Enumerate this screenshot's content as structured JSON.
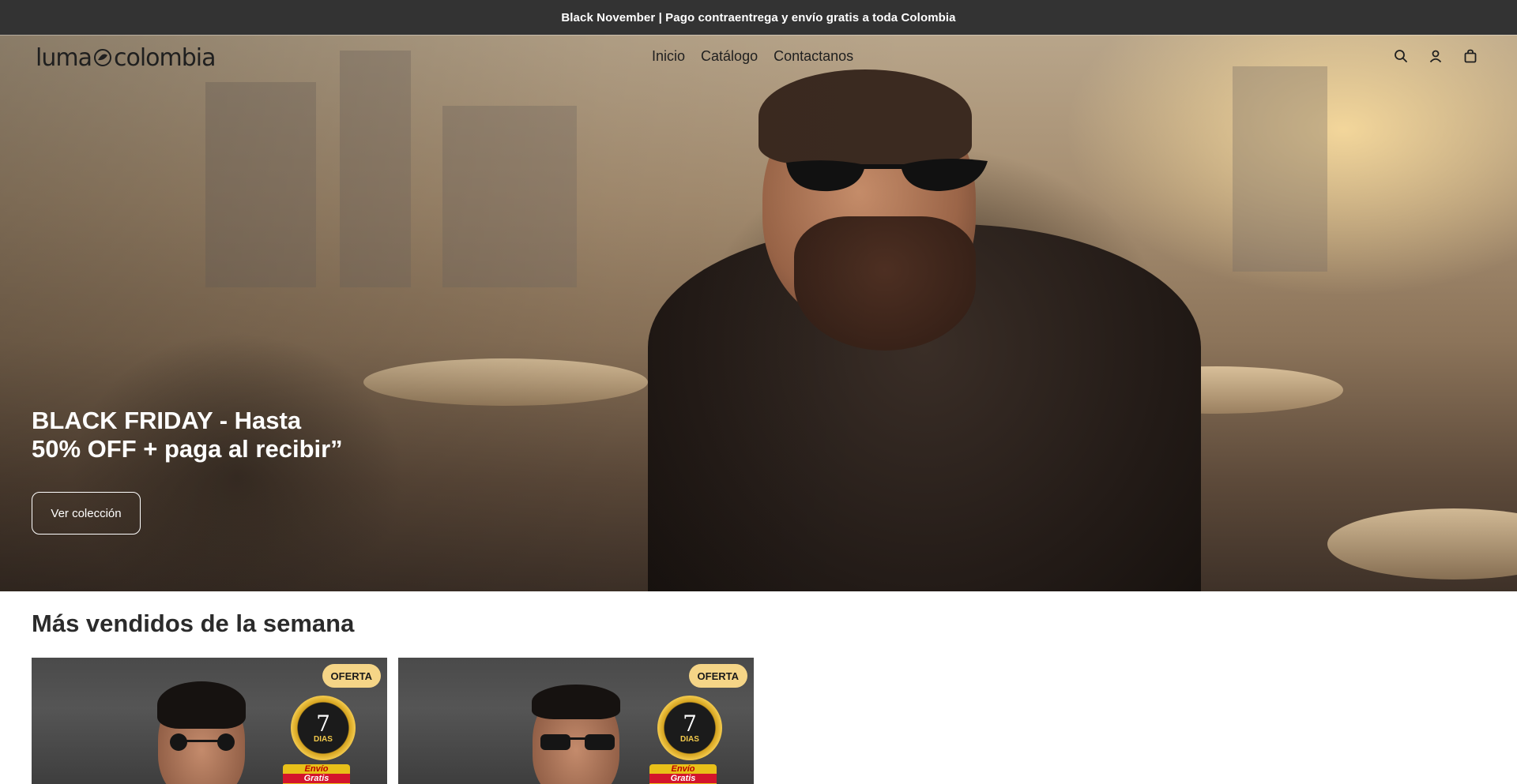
{
  "announcement": {
    "text": "Black November | Pago contraentrega y envío gratis a toda Colombia"
  },
  "header": {
    "logo_left": "luma",
    "logo_right": "colombia",
    "nav": [
      {
        "label": "Inicio"
      },
      {
        "label": "Catálogo"
      },
      {
        "label": "Contactanos"
      }
    ],
    "icons": [
      "search-icon",
      "account-icon",
      "cart-icon"
    ]
  },
  "hero": {
    "title_line1": "BLACK FRIDAY - Hasta",
    "title_line2": "50% OFF + paga al recibir”",
    "button_label": "Ver colección"
  },
  "bestsellers": {
    "title": "Más vendidos de la semana",
    "products": [
      {
        "badge": "OFERTA",
        "seal_number": "7",
        "seal_text": "DIAS",
        "shipping_label": "Envío",
        "shipping_sub": "Gratis"
      },
      {
        "badge": "OFERTA",
        "seal_number": "7",
        "seal_text": "DIAS",
        "shipping_label": "Envío",
        "shipping_sub": "Gratis"
      }
    ]
  },
  "colors": {
    "announcement_bg": "#333333",
    "badge_bg": "#f5d587",
    "text_dark": "#2b2b2b"
  }
}
